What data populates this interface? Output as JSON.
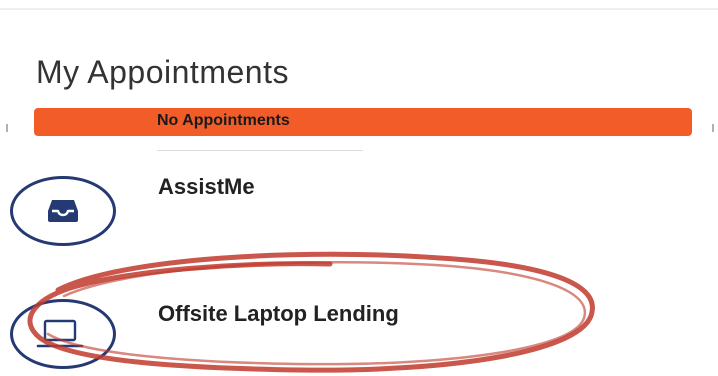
{
  "appointments": {
    "title": "My Appointments",
    "banner": {
      "text": "No Appointments",
      "color": "#f25c29"
    }
  },
  "services": [
    {
      "label": "AssistMe",
      "icon": "inbox-tray-icon"
    },
    {
      "label": "Offsite Laptop Lending",
      "icon": "laptop-icon"
    }
  ],
  "colors": {
    "accent": "#f25c29",
    "icon_ring": "#253a73",
    "annotation": "#c0392b"
  }
}
